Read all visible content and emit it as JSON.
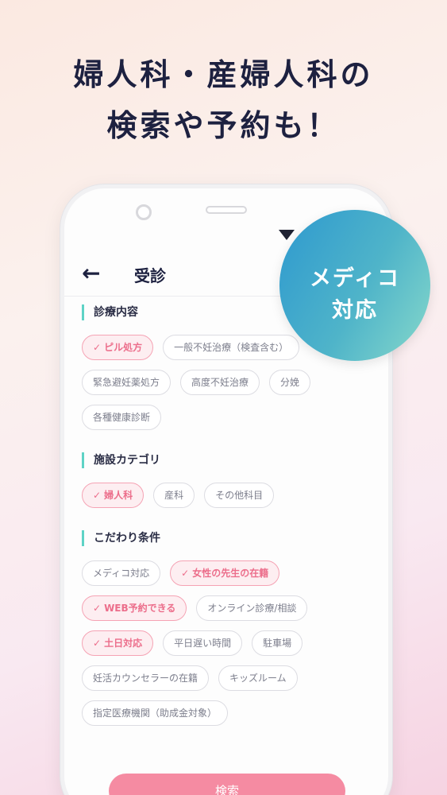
{
  "headline": {
    "line1": "婦人科・産婦人科の",
    "line2": "検索や予約も！"
  },
  "badge": {
    "line1": "メディコ",
    "line2": "対応"
  },
  "appbar": {
    "back_icon": "arrow-left-icon",
    "title": "受診"
  },
  "sections": [
    {
      "title": "診療内容",
      "chips": [
        {
          "label": "ピル処方",
          "selected": true
        },
        {
          "label": "一般不妊治療（検査含む）",
          "selected": false
        },
        {
          "label": "緊急避妊薬処方",
          "selected": false
        },
        {
          "label": "高度不妊治療",
          "selected": false
        },
        {
          "label": "分娩",
          "selected": false
        },
        {
          "label": "各種健康診断",
          "selected": false
        }
      ]
    },
    {
      "title": "施設カテゴリ",
      "chips": [
        {
          "label": "婦人科",
          "selected": true
        },
        {
          "label": "産科",
          "selected": false
        },
        {
          "label": "その他科目",
          "selected": false
        }
      ]
    },
    {
      "title": "こだわり条件",
      "chips": [
        {
          "label": "メディコ対応",
          "selected": false
        },
        {
          "label": "女性の先生の在籍",
          "selected": true
        },
        {
          "label": "WEB予約できる",
          "selected": true
        },
        {
          "label": "オンライン診療/相談",
          "selected": false
        },
        {
          "label": "土日対応",
          "selected": true
        },
        {
          "label": "平日遅い時間",
          "selected": false
        },
        {
          "label": "駐車場",
          "selected": false
        },
        {
          "label": "妊活カウンセラーの在籍",
          "selected": false
        },
        {
          "label": "キッズルーム",
          "selected": false
        },
        {
          "label": "指定医療機関（助成金対象）",
          "selected": false
        }
      ]
    }
  ],
  "search_button": "検索",
  "colors": {
    "accent_pink": "#ec6e8b",
    "teal_marker": "#5ed3c6",
    "text_dark": "#1d2140"
  }
}
